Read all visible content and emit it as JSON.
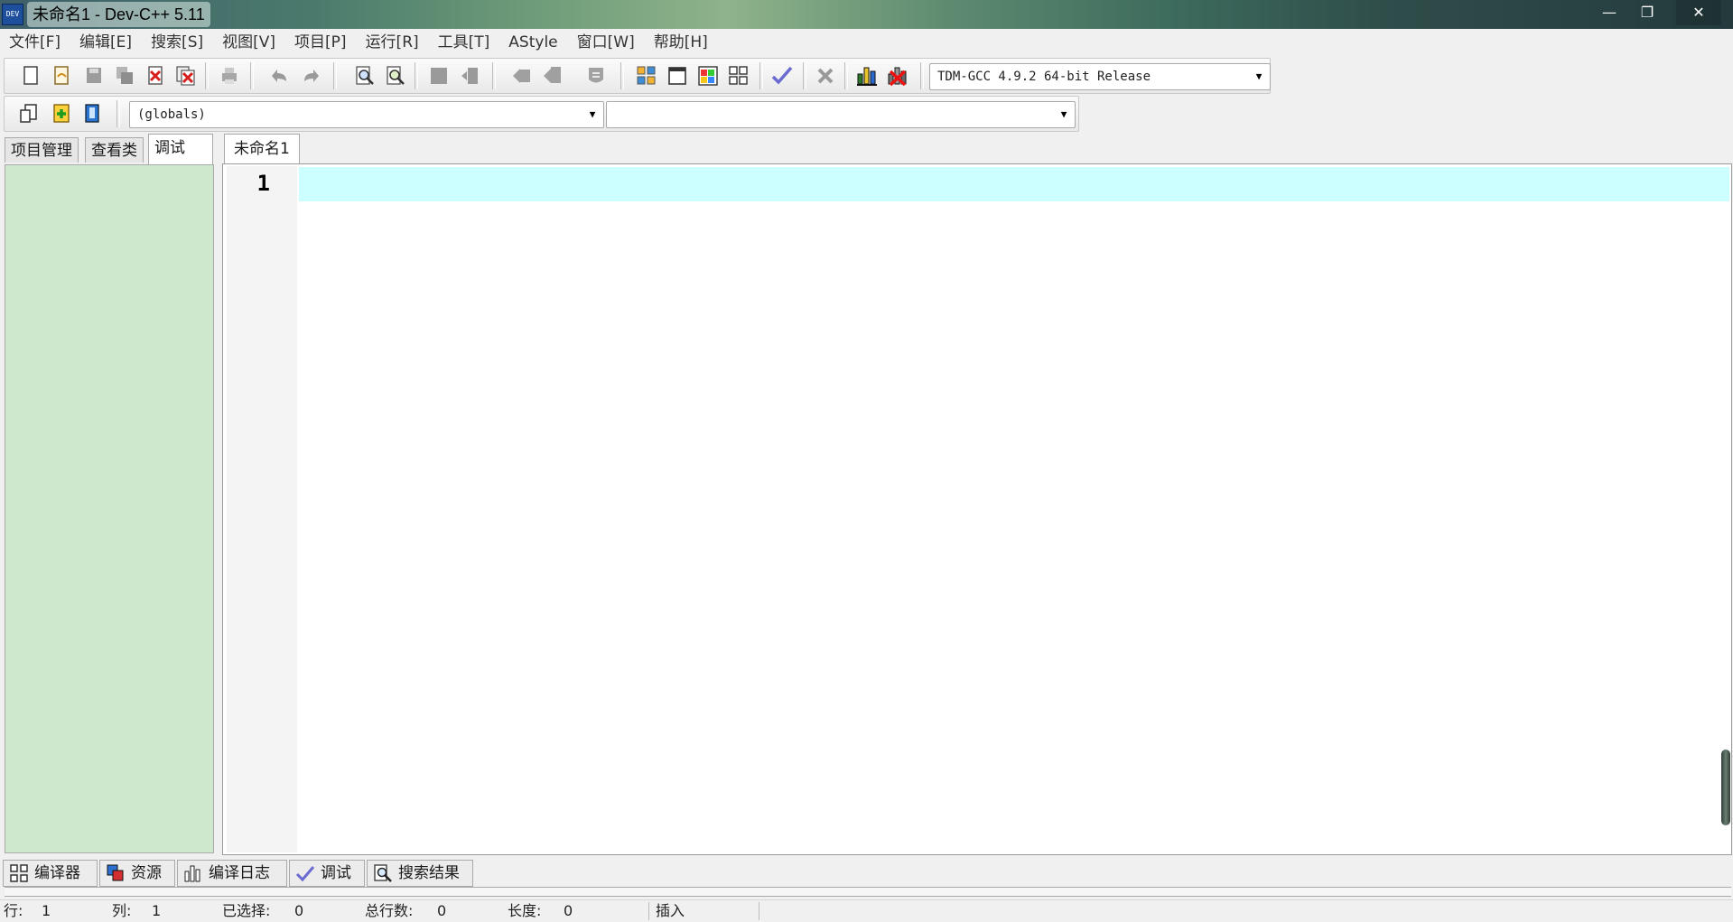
{
  "window": {
    "app_icon_text": "DEV",
    "title": "未命名1 - Dev-C++ 5.11",
    "controls": {
      "minimize": "—",
      "restore": "❐",
      "close": "✕"
    }
  },
  "menu": [
    "文件[F]",
    "编辑[E]",
    "搜索[S]",
    "视图[V]",
    "项目[P]",
    "运行[R]",
    "工具[T]",
    "AStyle",
    "窗口[W]",
    "帮助[H]"
  ],
  "toolbar": {
    "compiler_select": "TDM-GCC 4.9.2 64-bit Release",
    "icons": [
      "new-file-icon",
      "open-file-icon",
      "save-icon",
      "save-all-icon",
      "close-file-icon",
      "close-all-icon",
      "print-icon",
      "undo-icon",
      "redo-icon",
      "find-icon",
      "replace-icon",
      "indent-icon",
      "unindent-icon",
      "goto-prev-icon",
      "goto-next-icon",
      "bookmark-icon",
      "compile-icon",
      "run-icon",
      "compile-run-icon",
      "rebuild-icon",
      "syntax-check-icon",
      "stop-execution-icon",
      "profile-icon",
      "delete-profile-icon"
    ]
  },
  "toolbar2": {
    "icons": [
      "insert-icon",
      "toggle-bookmark-icon",
      "goto-bookmark-icon"
    ],
    "scope_select": "(globals)",
    "member_select": ""
  },
  "left_tabs": [
    "项目管理",
    "查看类",
    "调试"
  ],
  "left_active_tab": "调试",
  "editor": {
    "tab_label": "未命名1",
    "line_numbers": [
      "1"
    ],
    "current_line_color": "#ccffff",
    "panel_color": "#cde8cd"
  },
  "bottom_tabs": [
    {
      "label": "编译器",
      "icon": "grid-icon"
    },
    {
      "label": "资源",
      "icon": "resources-icon"
    },
    {
      "label": "编译日志",
      "icon": "bar-chart-icon"
    },
    {
      "label": "调试",
      "icon": "checkmark-icon"
    },
    {
      "label": "搜索结果",
      "icon": "search-results-icon"
    }
  ],
  "status": {
    "row_label": "行:",
    "row_value": "1",
    "col_label": "列:",
    "col_value": "1",
    "sel_label": "已选择:",
    "sel_value": "0",
    "lines_label": "总行数:",
    "lines_value": "0",
    "len_label": "长度:",
    "len_value": "0",
    "mode": "插入"
  }
}
